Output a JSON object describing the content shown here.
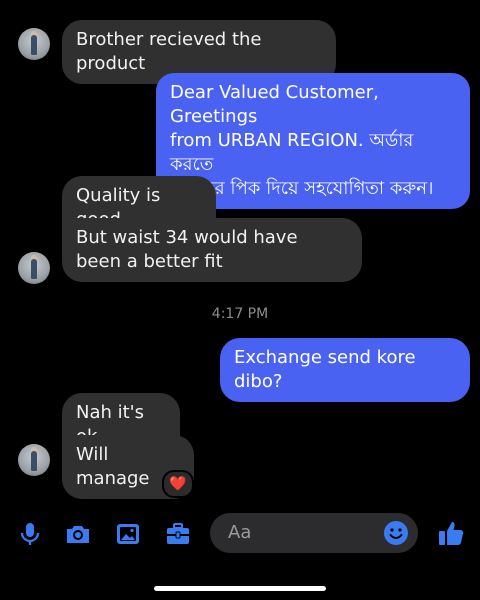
{
  "messages": {
    "m1": "Brother recieved the product",
    "m2_line1": "Dear Valued Customer, Greetings",
    "m2_line2": "from URBAN REGION. অর্ডার করতে",
    "m2_line3": "পছন্দের পিক দিয়ে সহযোগিতা করুন।",
    "m3": "Quality is good",
    "m4": "But waist 34 would have been a better fit",
    "timestamp": "4:17 PM",
    "m5": "Exchange send kore dibo?",
    "m6": "Nah it's ok",
    "m7": "Will manage",
    "reaction": "❤️"
  },
  "composer": {
    "placeholder": "Aa",
    "icons": [
      "microphone-icon",
      "camera-icon",
      "gallery-icon",
      "briefcase-icon",
      "emoji-icon",
      "thumbs-up-icon"
    ]
  },
  "colors": {
    "accent": "#3a7bf0",
    "outgoing_bubble": "#4a62f2",
    "incoming_bubble": "#303030",
    "background": "#000000"
  }
}
